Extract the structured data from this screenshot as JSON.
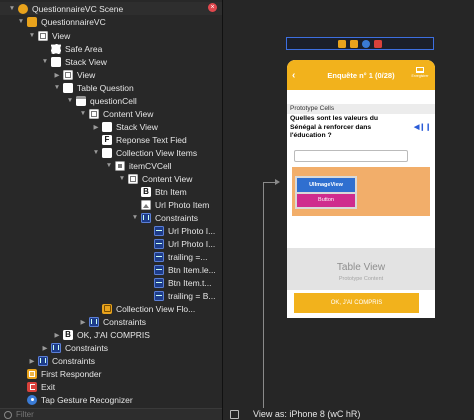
{
  "outline": {
    "close_glyph": "×",
    "filter_placeholder": "Filter",
    "rows": [
      {
        "label": "QuestionnaireVC Scene",
        "icon": "scene-icon",
        "expanded": true
      },
      {
        "label": "QuestionnaireVC",
        "icon": "view-controller-icon",
        "expanded": true
      },
      {
        "label": "View",
        "icon": "view-icon",
        "expanded": true
      },
      {
        "label": "Safe Area",
        "icon": "safe-area-icon",
        "expanded": null
      },
      {
        "label": "Stack View",
        "icon": "stack-view-icon",
        "expanded": true
      },
      {
        "label": "View",
        "icon": "view-icon",
        "expanded": false
      },
      {
        "label": "Table Question",
        "icon": "table-view-icon",
        "expanded": true
      },
      {
        "label": "questionCell",
        "icon": "table-cell-icon",
        "expanded": true
      },
      {
        "label": "Content View",
        "icon": "view-icon",
        "expanded": true
      },
      {
        "label": "Stack View",
        "icon": "stack-view-icon",
        "expanded": false
      },
      {
        "label": "Reponse Text Fied",
        "icon": "text-field-icon",
        "expanded": null
      },
      {
        "label": "Collection View Items",
        "icon": "collection-view-icon",
        "expanded": true
      },
      {
        "label": "itemCVCell",
        "icon": "collection-cell-icon",
        "expanded": true
      },
      {
        "label": "Content View",
        "icon": "view-icon",
        "expanded": true
      },
      {
        "label": "Btn Item",
        "icon": "button-icon",
        "expanded": null
      },
      {
        "label": "Url Photo Item",
        "icon": "image-view-icon",
        "expanded": null
      },
      {
        "label": "Constraints",
        "icon": "constraints-icon",
        "expanded": true
      },
      {
        "label": "Url Photo I...",
        "icon": "constraint-icon",
        "expanded": null
      },
      {
        "label": "Url Photo I...",
        "icon": "constraint-icon",
        "expanded": null
      },
      {
        "label": "trailing =...",
        "icon": "constraint-icon",
        "expanded": null
      },
      {
        "label": "Btn Item.le...",
        "icon": "constraint-icon",
        "expanded": null
      },
      {
        "label": "Btn Item.t...",
        "icon": "constraint-icon",
        "expanded": null
      },
      {
        "label": "trailing = B...",
        "icon": "constraint-icon",
        "expanded": null
      },
      {
        "label": "Collection View Flo...",
        "icon": "flow-layout-icon",
        "expanded": null
      },
      {
        "label": "Constraints",
        "icon": "constraints-icon",
        "expanded": false
      },
      {
        "label": "OK, J'AI COMPRIS",
        "icon": "button-icon",
        "expanded": false
      },
      {
        "label": "Constraints",
        "icon": "constraints-icon",
        "expanded": false
      },
      {
        "label": "Constraints",
        "icon": "constraints-icon",
        "expanded": false
      },
      {
        "label": "First Responder",
        "icon": "first-responder-icon",
        "expanded": null
      },
      {
        "label": "Exit",
        "icon": "exit-icon",
        "expanded": null
      },
      {
        "label": "Tap Gesture Recognizer",
        "icon": "tap-gesture-icon",
        "expanded": null
      }
    ]
  },
  "canvas": {
    "nav_back_glyph": "‹",
    "nav_title": "Enquête n° 1 (0/28)",
    "nav_right_label": "Enregistrer",
    "prototype_cells_label": "Prototype Cells",
    "question": "Quelles sont les valeurs du Sénégal à renforcer dans l'éducation ?",
    "play_glyph": "◀❙❙",
    "image_view_label": "UIImageView",
    "button_label": "Button",
    "table_view_title": "Table View",
    "table_view_subtitle": "Prototype Content",
    "ok_button_label": "OK, J'AI COMPRIS",
    "view_as": "View as: iPhone 8 (wC hR)"
  },
  "colors": {
    "accent_yellow": "#f2b21c",
    "collection_orange": "#f2ae6a",
    "image_view_blue": "#2f6fd0",
    "button_pink": "#cf2c8e",
    "selection_blue": "#3d6fe0"
  }
}
